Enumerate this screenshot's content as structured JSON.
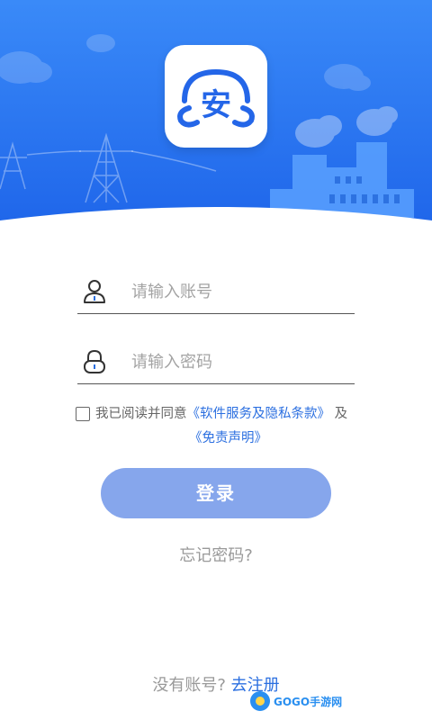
{
  "colors": {
    "primary": "#2f7bf5",
    "link": "#2b6fe0",
    "button": "#86a6ec"
  },
  "logo": {
    "char": "安",
    "icon": "cloud-shield-logo"
  },
  "account": {
    "placeholder": "请输入账号",
    "icon": "user-icon"
  },
  "password": {
    "placeholder": "请输入密码",
    "icon": "lock-icon"
  },
  "agreement": {
    "prefix": "我已阅读并同意",
    "service_link": "《软件服务及隐私条款》",
    "and": "及",
    "disclaimer_link": "《免责声明》"
  },
  "login_label": "登录",
  "forgot_label": "忘记密码?",
  "register": {
    "prompt": "没有账号?",
    "link": "去注册"
  },
  "watermark": "GOGO手游网"
}
